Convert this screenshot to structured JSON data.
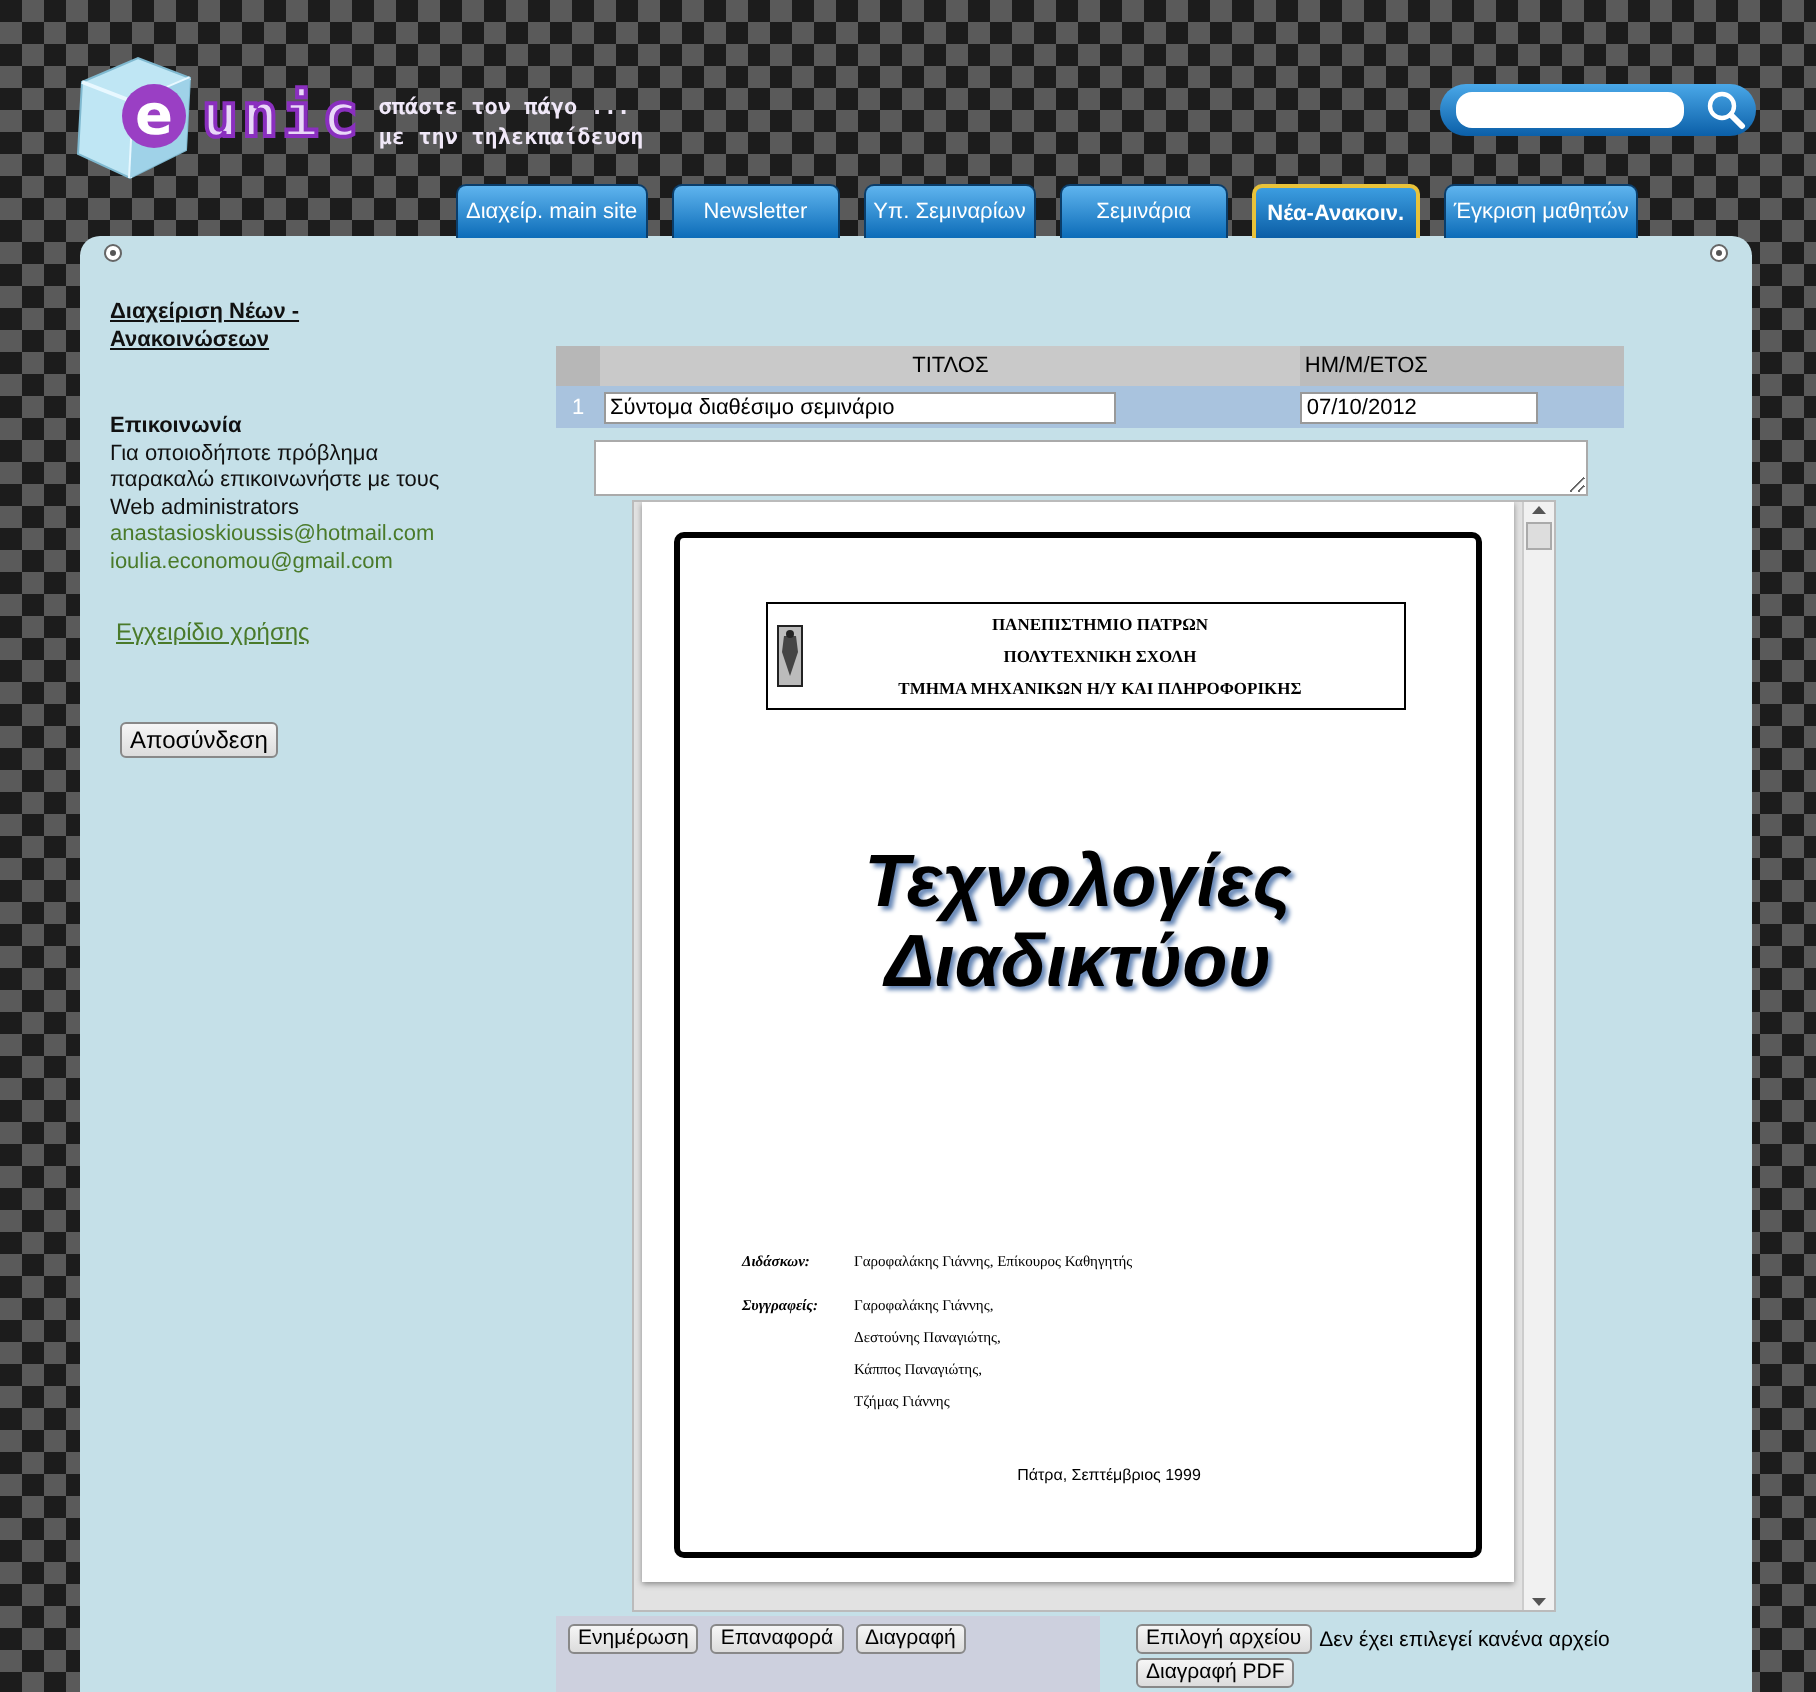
{
  "header": {
    "logo": {
      "letter": "e",
      "word": "unic"
    },
    "tagline": [
      "σπάστε τον πάγο ...",
      "με την τηλεκπαίδευση"
    ]
  },
  "nav_tabs": [
    {
      "label": "Διαχείρ. main site",
      "selected": false
    },
    {
      "label": "Newsletter",
      "selected": false
    },
    {
      "label": "Υπ. Σεμιναρίων",
      "selected": false
    },
    {
      "label": "Σεμινάρια",
      "selected": false
    },
    {
      "label": "Νέα-Ανακοιν.",
      "selected": true
    },
    {
      "label": "Έγκριση μαθητών",
      "selected": false
    }
  ],
  "sidebar": {
    "heading_link": "Διαχείριση Νέων - Ανακοινώσεων",
    "contact_title": "Επικοινωνία",
    "contact_text": "Για οποιοδήποτε πρόβλημα παρακαλώ επικοινωνήστε με τους Web administrators",
    "emails": [
      "anastasioskioussis@hotmail.com",
      "ioulia.economou@gmail.com"
    ],
    "manual_link": "Εγχειρίδιο χρήσης",
    "logout_button": "Αποσύνδεση"
  },
  "table": {
    "columns": [
      "ΤΙΤΛΟΣ",
      "ΗΜ/Μ/ΕΤΟΣ"
    ],
    "rows": [
      {
        "number": "1",
        "title": "Σύντομα διαθέσιμο σεμινάριο",
        "date": "07/10/2012"
      }
    ]
  },
  "pdf_page": {
    "header_lines": [
      "ΠΑΝΕΠΙΣΤΗΜΙΟ ΠΑΤΡΩΝ",
      "ΠΟΛΥΤΕΧΝΙΚΗ ΣΧΟΛΗ",
      "ΤΜΗΜΑ ΜΗΧΑΝΙΚΩΝ Η/Υ ΚΑΙ ΠΛΗΡΟΦΟΡΙΚΗΣ"
    ],
    "title_lines": [
      "Τεχνολογίες",
      "Διαδικτύου"
    ],
    "credits": [
      {
        "label": "Διδάσκων:",
        "names": [
          "Γαροφαλάκης Γιάννης, Επίκουρος Καθηγητής"
        ]
      },
      {
        "label": "Συγγραφείς:",
        "names": [
          "Γαροφαλάκης Γιάννης,",
          "Δεστούνης Παναγιώτης,",
          "Κάππος Παναγιώτης,",
          "Τζήμας Γιάννης"
        ]
      }
    ],
    "footer": "Πάτρα, Σεπτέμβριος 1999"
  },
  "actions": {
    "buttons": [
      "Ενημέρωση",
      "Επαναφορά",
      "Διαγραφή"
    ],
    "file_button": "Επιλογή αρχείου",
    "file_status": "Δεν έχει επιλεγεί κανένα αρχείο",
    "delete_pdf_button": "Διαγραφή PDF"
  }
}
